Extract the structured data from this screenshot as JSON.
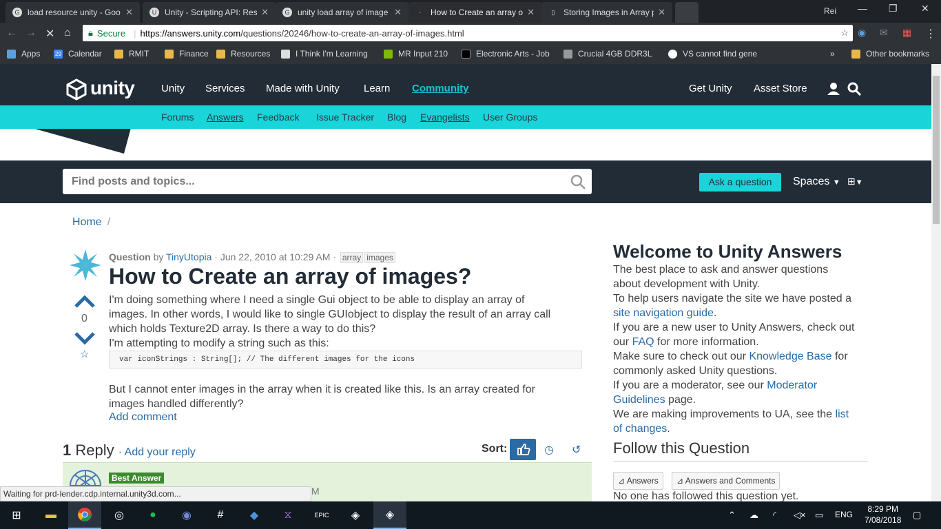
{
  "browser": {
    "tabs": [
      {
        "title": "load resource unity - Goo",
        "icon": "G"
      },
      {
        "title": "Unity - Scripting API: Res",
        "icon": "U"
      },
      {
        "title": "unity load array of image",
        "icon": "G"
      },
      {
        "title": "How to Create an array o",
        "icon": ""
      },
      {
        "title": "Storing Images in Array p",
        "icon": ""
      }
    ],
    "user": "Rei",
    "secure": "Secure",
    "url_domain": "https://answers.unity.com",
    "url_path": "/questions/20246/how-to-create-an-array-of-images.html",
    "bookmarks": [
      "Apps",
      "Calendar",
      "RMIT",
      "Finance",
      "Resources",
      "I Think I'm Learning",
      "MR Input 210",
      "Electronic Arts - Job",
      "Crucial 4GB DDR3L",
      "VS cannot find gene"
    ],
    "bookmarks_more": "»",
    "other_bookmarks": "Other bookmarks",
    "calendar_day": "29"
  },
  "unity": {
    "logo": "unity",
    "nav": [
      "Unity",
      "Services",
      "Made with Unity",
      "Learn",
      "Community"
    ],
    "nav_right": [
      "Get Unity",
      "Asset Store"
    ],
    "subnav": [
      "Forums",
      "Answers",
      "Feedback",
      "Issue Tracker",
      "Blog",
      "Evangelists",
      "User Groups"
    ],
    "search_placeholder": "Find posts and topics...",
    "ask": "Ask a question",
    "spaces": "Spaces"
  },
  "content": {
    "crumb": "Home",
    "crumb_sep": "/",
    "meta_question": "Question",
    "meta_by": "by",
    "meta_user": "TinyUtopia",
    "meta_date": "· Jun 22, 2010 at 10:29 AM ·",
    "tags": [
      "array",
      "images"
    ],
    "title": "How to Create an array of images?",
    "votes": "0",
    "p1": "I'm doing something where I need a single Gui object to be able to display an array of",
    "p2": "images. In other words, I would like to single GUIobject to display the result of an array call",
    "p3": "which holds Texture2D array. Is there a way to do this?",
    "p4": "I'm attempting to modify a string such as this:",
    "code": "var iconStrings : String[]; // The different images for the icons",
    "p5": "But I cannot enter images in the array when it is created like this. Is an array created for",
    "p6": "images handled differently?",
    "add_comment": "Add comment",
    "reply_count": "1",
    "reply_word": "Reply",
    "add_reply": "· Add your reply",
    "sort": "Sort:",
    "best_answer": "Best Answer",
    "partial_time": "M"
  },
  "sidebar": {
    "welcome": "Welcome to Unity Answers",
    "l1": "The best place to ask and answer questions",
    "l2": "about development with Unity.",
    "l3": "To help users navigate the site we have posted a",
    "l4a": "site navigation guide",
    "l4b": ".",
    "l5": "If you are a new user to Unity Answers, check out",
    "l6a": "our ",
    "l6b": "FAQ",
    "l6c": " for more information.",
    "l7a": "Make sure to check out our ",
    "l7b": "Knowledge Base",
    "l7c": " for",
    "l8": "commonly asked Unity questions.",
    "l9a": "If you are a moderator, see our ",
    "l9b": "Moderator",
    "l10a": "Guidelines",
    "l10b": " page.",
    "l11a": "We are making improvements to UA, see the ",
    "l11b": "list",
    "l12a": "of changes",
    "l12b": ".",
    "follow": "Follow this Question",
    "rss1": "Answers",
    "rss2": "Answers and Comments",
    "nofollow": "No one has followed this question yet."
  },
  "status": "Waiting for prd-lender.cdp.internal.unity3d.com...",
  "taskbar": {
    "lang": "ENG",
    "time": "8:29 PM",
    "date": "7/08/2018"
  }
}
